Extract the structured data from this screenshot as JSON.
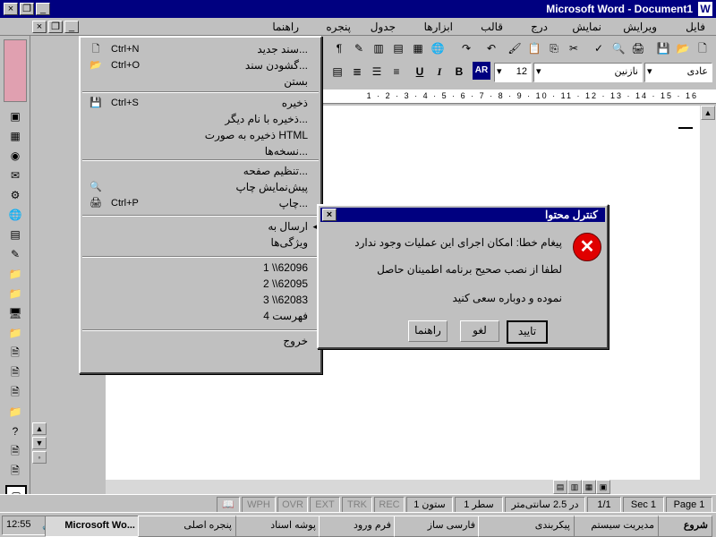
{
  "window": {
    "title": "Microsoft Word - Document1",
    "app_icon": "W"
  },
  "menubar": {
    "items": [
      "فایل",
      "ویرایش",
      "نمایش",
      "درج",
      "قالب",
      "ابزارها",
      "جدول",
      "پنجره",
      "راهنما"
    ]
  },
  "toolbar": {
    "style_value": "عادی",
    "font_value": "نازنین",
    "size_value": "12",
    "ar_badge": "AR",
    "bold_label": "B",
    "italic_label": "I",
    "underline_label": "U"
  },
  "file_menu": {
    "items": [
      {
        "label": "سند جدید...",
        "shortcut": "Ctrl+N",
        "icon": "new-doc-icon"
      },
      {
        "label": "گشودن سند...",
        "shortcut": "Ctrl+O",
        "icon": "open-folder-icon"
      },
      {
        "label": "بستن",
        "shortcut": "",
        "icon": ""
      },
      {
        "label": "ذخیره",
        "shortcut": "Ctrl+S",
        "icon": "save-icon"
      },
      {
        "label": "ذخیره با نام دیگر...",
        "shortcut": "",
        "icon": ""
      },
      {
        "label": "ذخیره به صورت HTML",
        "shortcut": "",
        "icon": ""
      },
      {
        "label": "نسخه‌ها...",
        "shortcut": "",
        "icon": ""
      },
      {
        "label": "تنظیم صفحه...",
        "shortcut": "",
        "icon": ""
      },
      {
        "label": "پیش‌نمایش چاپ",
        "shortcut": "",
        "icon": "print-preview-icon"
      },
      {
        "label": "چاپ...",
        "shortcut": "Ctrl+P",
        "icon": "print-icon"
      },
      {
        "label": "ارسال به",
        "shortcut": "",
        "icon": ""
      },
      {
        "label": "ویژگی‌ها",
        "shortcut": "",
        "icon": ""
      },
      {
        "label": "1 \\\\62096",
        "shortcut": "",
        "icon": ""
      },
      {
        "label": "2 \\\\62095",
        "shortcut": "",
        "icon": ""
      },
      {
        "label": "3 \\\\62083",
        "shortcut": "",
        "icon": ""
      },
      {
        "label": "4 فهرست",
        "shortcut": "",
        "icon": ""
      },
      {
        "label": "خروج",
        "shortcut": "",
        "icon": ""
      }
    ]
  },
  "dialog": {
    "title": "کنترل محتوا",
    "lines": [
      "پیغام خطا: امکان اجرای این عملیات وجود ندارد",
      "لطفا از نصب صحیح برنامه اطمینان حاصل",
      "نموده و دوباره سعی کنید"
    ],
    "buttons": [
      "تایید",
      "لغو",
      "راهنما"
    ],
    "close_glyph": "×",
    "error_glyph": "✕"
  },
  "ruler": {
    "marks": "1 · 2 · 3 · 4 · 5 · 6 · 7 · 8 · 9 · 10 · 11 · 12 · 13 · 14 · 15 · 16"
  },
  "statusbar": {
    "page": "Page 1",
    "sec": "Sec 1",
    "pages": "1/1",
    "position": "در 2.5 سانتی‌متر",
    "line": "سطر 1",
    "col": "ستون 1",
    "rec": "REC",
    "trk": "TRK",
    "ext": "EXT",
    "ovr": "OVR",
    "wph": "WPH"
  },
  "taskbar": {
    "clock": "12:55",
    "tasks": [
      "شروع",
      "مدیریت سیستم",
      "Microsoft Wo...",
      "پوشه اسناد",
      "فرم ورود",
      "فارسی ساز",
      "پیکربندی",
      "پنجره اصلی"
    ],
    "tray_badge": "AR"
  }
}
